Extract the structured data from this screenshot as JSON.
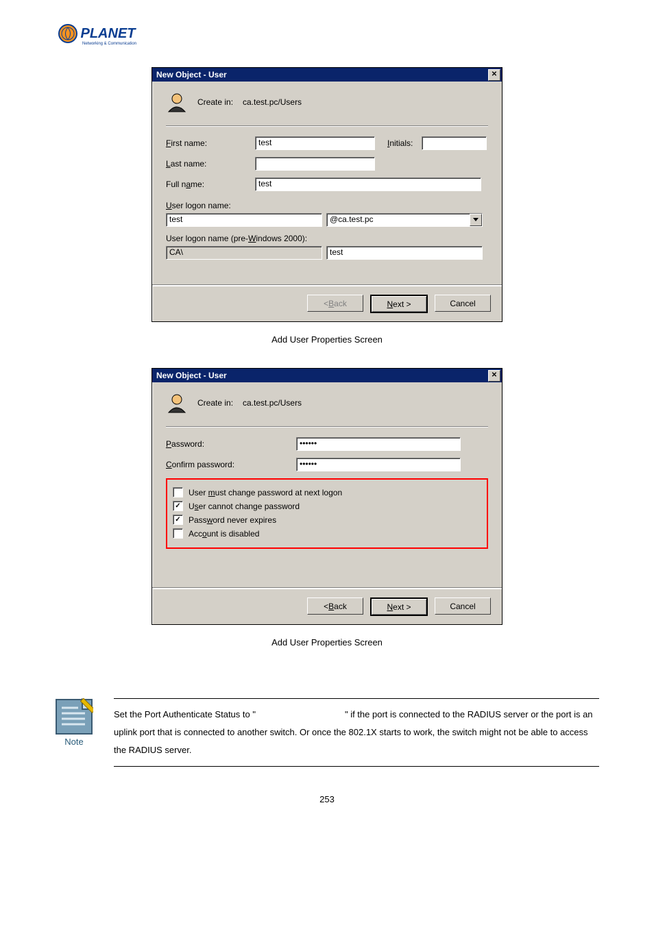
{
  "dialog1": {
    "title": "New Object - User",
    "create_in_label": "Create in:",
    "create_in_value": "ca.test.pc/Users",
    "first_name_label": "First name:",
    "first_name_value": "test",
    "initials_label": "Initials:",
    "initials_value": "",
    "last_name_label": "Last name:",
    "last_name_value": "",
    "full_name_label": "Full name:",
    "full_name_value": "test",
    "user_logon_label": "User logon name:",
    "user_logon_value": "test",
    "domain_selected": "@ca.test.pc",
    "pre2000_label": "User logon name (pre-Windows 2000):",
    "pre2000_domain": "CA\\",
    "pre2000_user": "test",
    "buttons": {
      "back": "< Back",
      "next": "Next >",
      "cancel": "Cancel"
    }
  },
  "caption1": "Add User Properties Screen",
  "dialog2": {
    "title": "New Object - User",
    "create_in_label": "Create in:",
    "create_in_value": "ca.test.pc/Users",
    "password_label": "Password:",
    "password_value": "••••••",
    "confirm_label": "Confirm password:",
    "confirm_value": "••••••",
    "opt_must_change": "User must change password at next logon",
    "opt_cannot_change": "User cannot change password",
    "opt_never_expires": "Password never expires",
    "opt_disabled": "Account is disabled",
    "buttons": {
      "back": "< Back",
      "next": "Next >",
      "cancel": "Cancel"
    }
  },
  "caption2": "Add User Properties Screen",
  "note": {
    "label": "Note",
    "text_a": "Set the Port Authenticate Status to \"",
    "text_b": "\" if the port is connected to the RADIUS server or the port is an uplink port that is connected to another switch. Or once the 802.1X starts to work, the switch might not be able to access the RADIUS server."
  },
  "page_number": "253",
  "chart_data": null
}
